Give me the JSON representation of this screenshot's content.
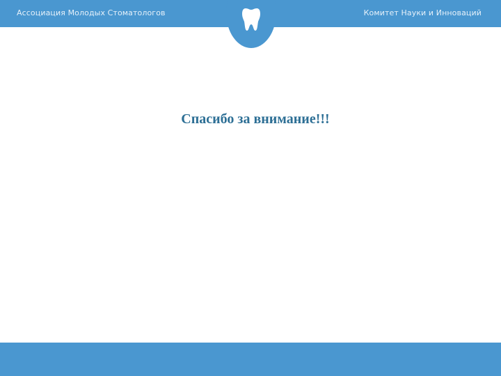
{
  "header": {
    "left_text": "Ассоциация Молодых Стоматологов",
    "right_text": "Комитет Науки и Инноваций",
    "logo_icon": "tooth-icon"
  },
  "slide": {
    "title": "Спасибо за внимание!!!"
  },
  "colors": {
    "accent": "#4a97d0",
    "title": "#2d6f95",
    "header_text": "#e6f1fa",
    "background": "#ffffff"
  }
}
